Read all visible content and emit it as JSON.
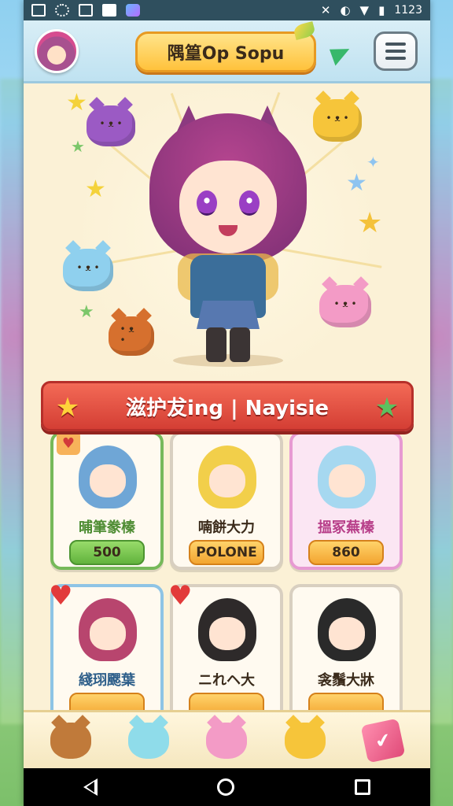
{
  "status_bar": {
    "time": "1123",
    "left_icons": [
      "notification-box-icon",
      "gear-icon",
      "photo-icon",
      "note-icon",
      "app-icon"
    ],
    "right_icons": [
      "mute-icon",
      "data-saver-icon",
      "wifi-icon",
      "battery-icon"
    ]
  },
  "header": {
    "title": "隅篁Op Sopu",
    "menu_icon": "hamburger-menu-icon"
  },
  "section": {
    "banner_title": "滋护犮ing | Nayisie"
  },
  "cards": [
    {
      "name": "晡筆豢榛",
      "price": "500",
      "theme": "green",
      "badge": "heart"
    },
    {
      "name": "喃餅大力",
      "price": "POLONE",
      "theme": "plain",
      "badge": ""
    },
    {
      "name": "搵冢蕪榛",
      "price": "860",
      "theme": "pink",
      "badge": ""
    },
    {
      "name": "綫珝颸葉",
      "price": "",
      "theme": "blue",
      "badge": "heart"
    },
    {
      "name": "ニれヘ大",
      "price": "",
      "theme": "plain",
      "badge": "heart"
    },
    {
      "name": "衾鬚大牀",
      "price": "",
      "theme": "plain",
      "badge": ""
    }
  ],
  "bottom_nav": [
    {
      "name": "dog-pet-icon"
    },
    {
      "name": "ghost-cat-pet-icon"
    },
    {
      "name": "pink-cat-pet-icon"
    },
    {
      "name": "yellow-cat-pet-icon"
    },
    {
      "name": "card-collection-icon"
    }
  ],
  "colors": {
    "banner_red": "#d43e34",
    "title_gold": "#ffc23c",
    "card_green": "#76b95a",
    "card_pink": "#e79ad2",
    "price_green": "#62b33d",
    "price_orange": "#f3a531"
  }
}
